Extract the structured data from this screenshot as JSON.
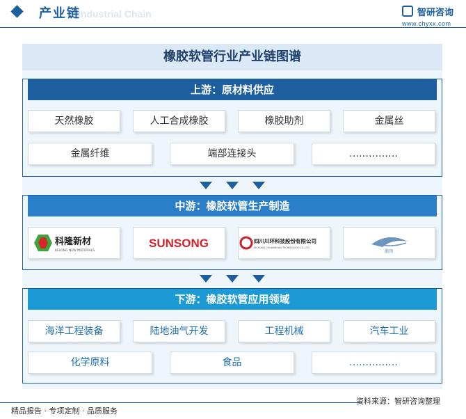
{
  "header": {
    "title": "产业链",
    "subtitle": "Industrial Chain",
    "brand_name": "智研咨询",
    "brand_url": "www.chyxx.com"
  },
  "main_title": "橡胶软管行业产业链图谱",
  "upstream": {
    "title": "上游：原材料供应",
    "row1": [
      "天然橡胶",
      "人工合成橡胶",
      "橡胶助剂",
      "金属丝"
    ],
    "row2": [
      "金属纤维",
      "端部连接头",
      "……………"
    ]
  },
  "midstream": {
    "title": "中游：橡胶软管生产制造",
    "companies": [
      {
        "name": "科隆新材",
        "sub": "KELONG NEW MATERIALS"
      },
      {
        "name": "SUNSONG"
      },
      {
        "name": "四川川环科技股份有限公司",
        "sub": "SICHUAN CHUANHUAN TECHNOLOGY CO.,LTD"
      },
      {
        "name": "鹏翎"
      }
    ]
  },
  "downstream": {
    "title": "下游：橡胶软管应用领域",
    "row1": [
      "海洋工程装备",
      "陆地油气开发",
      "工程机械",
      "汽车工业"
    ],
    "row2": [
      "化学原料",
      "食品",
      "……………"
    ]
  },
  "footer": {
    "left": "精品报告 · 专项定制 · 品质服务",
    "source": "资料来源：智研咨询整理"
  },
  "colors": {
    "upstream_bar": "#1d5f9e",
    "midstream_bar": "#2a7fc8",
    "downstream_bar": "#1c9ad6",
    "text_blue": "#1d6fb0"
  }
}
